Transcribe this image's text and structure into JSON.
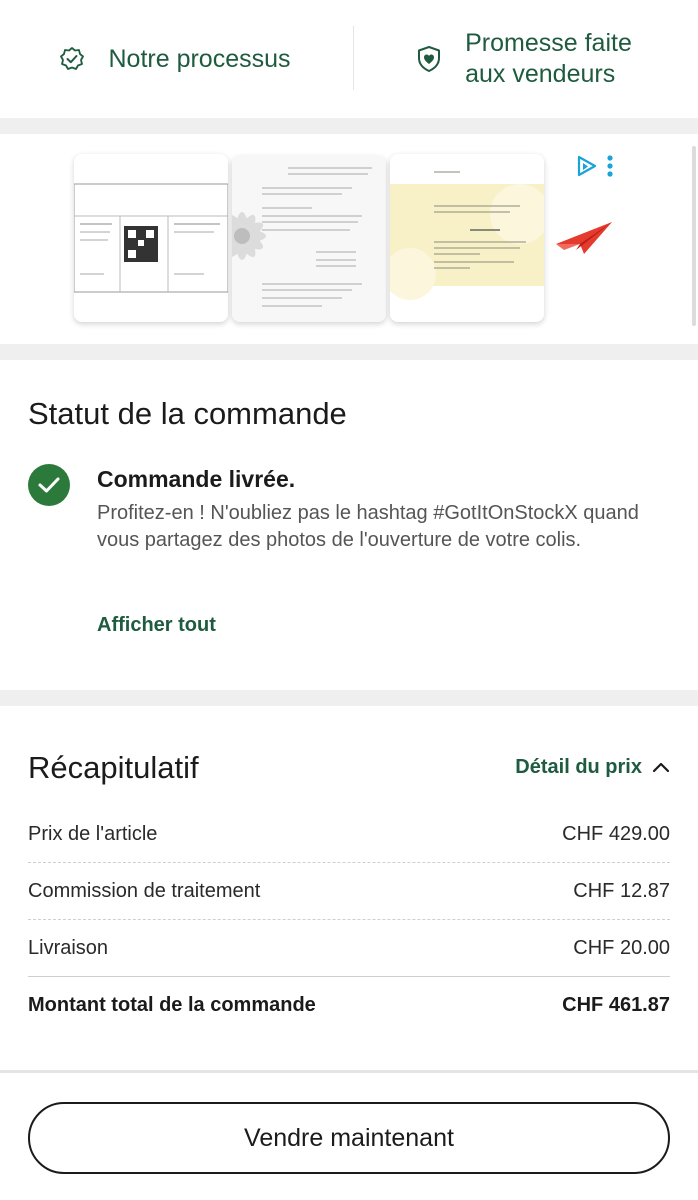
{
  "top_links": [
    {
      "label": "Notre processus",
      "icon": "verified-badge-icon"
    },
    {
      "label": "Promesse faite\naux vendeurs",
      "icon": "shield-heart-icon"
    }
  ],
  "ad": {
    "images": [
      "ad-label-image",
      "ad-letter-flower-image",
      "ad-yellow-card-image"
    ],
    "icons": [
      "ad-choices-icon",
      "more-vertical-icon",
      "paper-plane-icon"
    ]
  },
  "status": {
    "title": "Statut de la commande",
    "headline": "Commande livrée.",
    "description": "Profitez-en ! N'oubliez pas le hashtag #GotItOnStockX quand vous partagez des photos de l'ouverture de votre colis.",
    "show_all": "Afficher tout"
  },
  "summary": {
    "title": "Récapitulatif",
    "price_detail": "Détail du prix",
    "rows": [
      {
        "label": "Prix de l'article",
        "value": "CHF 429.00"
      },
      {
        "label": "Commission de traitement",
        "value": "CHF 12.87"
      },
      {
        "label": "Livraison",
        "value": "CHF 20.00"
      },
      {
        "label": "Montant total de la commande",
        "value": "CHF 461.87"
      }
    ]
  },
  "sell_button": "Vendre maintenant",
  "colors": {
    "accent": "#1f5b3f",
    "check": "#2c7a3b",
    "band": "#efefef"
  }
}
